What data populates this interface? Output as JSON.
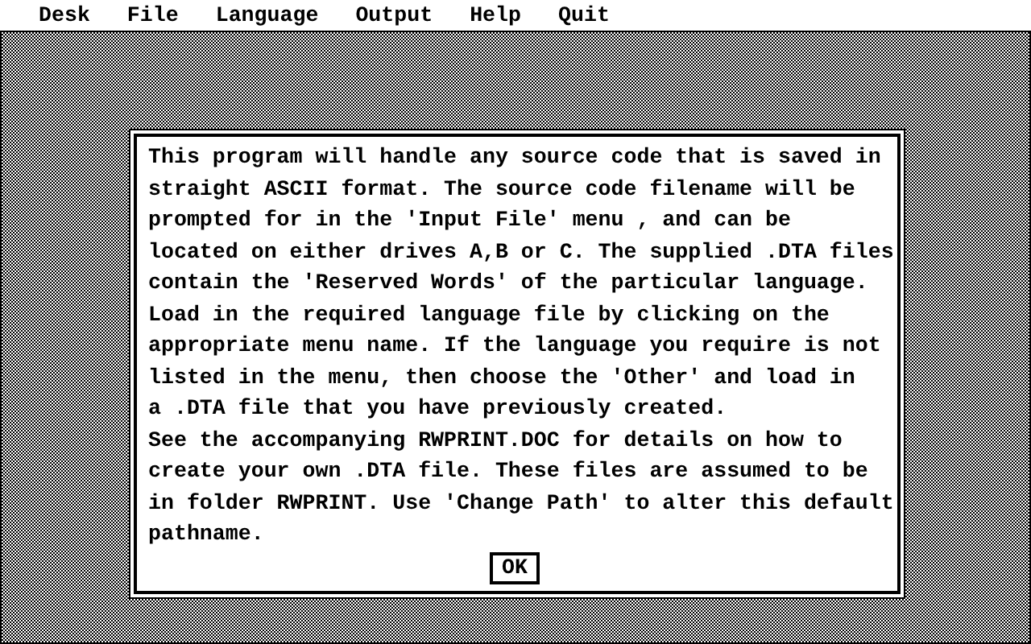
{
  "menu_bar": {
    "items": [
      "Desk",
      "File",
      "Language",
      "Output",
      "Help",
      "Quit"
    ]
  },
  "dialog": {
    "lines": [
      "This program will handle any source code that is saved in",
      "straight ASCII format. The source code filename will be",
      "prompted for in the 'Input File' menu , and can be",
      "located on either drives A,B or C. The supplied .DTA files",
      "contain the 'Reserved Words' of the particular language.",
      "Load in the required language file by clicking on the",
      "appropriate menu name. If the language you require is not",
      "listed in the menu, then choose the 'Other' and load in",
      "a .DTA file that you have previously created.",
      "See the accompanying RWPRINT.DOC for details on how to",
      "create your own .DTA file. These files are assumed to be",
      "in folder RWPRINT. Use 'Change Path' to alter this default",
      "pathname."
    ],
    "button": "OK"
  }
}
